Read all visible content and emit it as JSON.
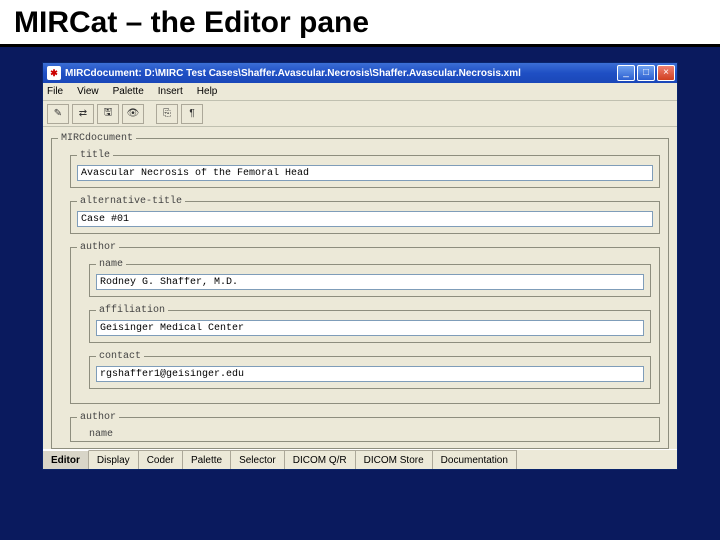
{
  "slide": {
    "title": "MIRCat – the Editor pane"
  },
  "window": {
    "title": "MIRCdocument: D:\\MIRC Test Cases\\Shaffer.Avascular.Necrosis\\Shaffer.Avascular.Necrosis.xml",
    "buttons": {
      "min": "_",
      "max": "□",
      "close": "×"
    }
  },
  "menubar": {
    "items": [
      "File",
      "View",
      "Palette",
      "Insert",
      "Help"
    ]
  },
  "toolbar": {
    "icons": [
      "new-icon",
      "open-icon",
      "save-icon",
      "preview-icon",
      "sep",
      "export-icon",
      "pilcrow-icon"
    ],
    "glyphs": {
      "new-icon": "✎",
      "open-icon": "⇄",
      "save-icon": "🖫",
      "preview-icon": "👁",
      "export-icon": "⎘",
      "pilcrow-icon": "¶"
    }
  },
  "root": {
    "legend": "MIRCdocument",
    "title": {
      "label": "title",
      "value": "Avascular Necrosis of the Femoral Head"
    },
    "alt_title": {
      "label": "alternative-title",
      "value": "Case #01"
    },
    "author1": {
      "legend": "author",
      "name": {
        "label": "name",
        "value": "Rodney G. Shaffer, M.D."
      },
      "affiliation": {
        "label": "affiliation",
        "value": "Geisinger Medical Center"
      },
      "contact": {
        "label": "contact",
        "value": "rgshaffer1@geisinger.edu"
      }
    },
    "author2": {
      "legend": "author",
      "name": {
        "label": "name",
        "value": ""
      }
    }
  },
  "tabs": [
    "Editor",
    "Display",
    "Coder",
    "Palette",
    "Selector",
    "DICOM Q/R",
    "DICOM Store",
    "Documentation"
  ],
  "active_tab": "Editor"
}
